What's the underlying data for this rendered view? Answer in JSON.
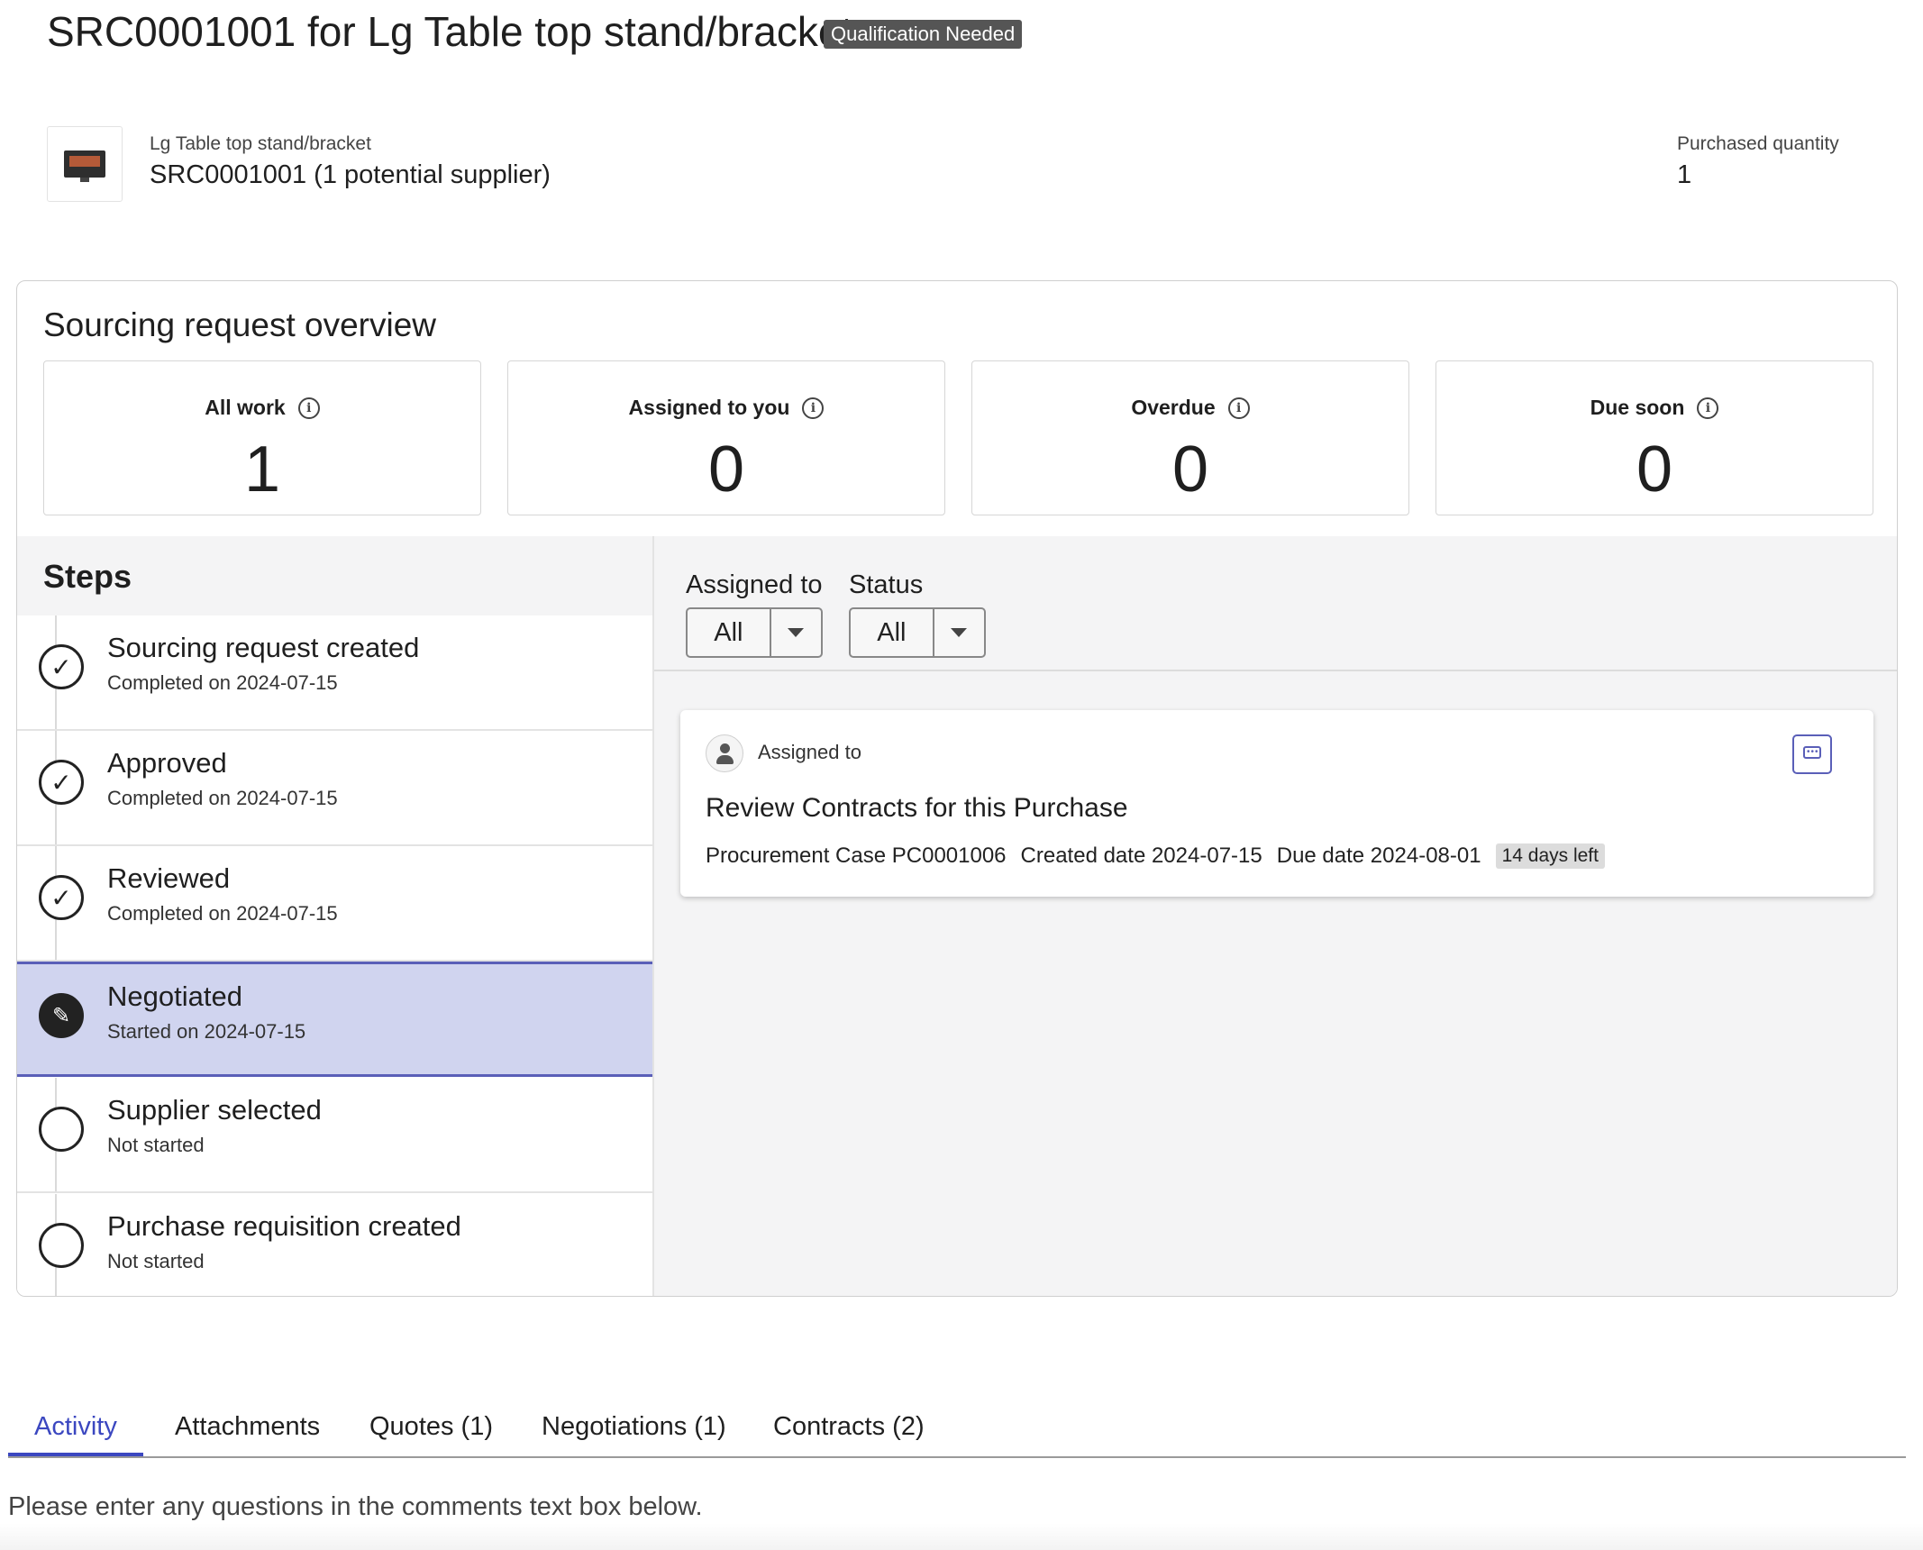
{
  "header": {
    "title": "SRC0001001 for Lg Table top stand/bracket",
    "badge": "Qualification Needed"
  },
  "item": {
    "name": "Lg Table top stand/bracket",
    "reference": "SRC0001001 (1 potential supplier)",
    "quantity_label": "Purchased quantity",
    "quantity_value": "1"
  },
  "overview": {
    "title": "Sourcing request overview",
    "stats": [
      {
        "label": "All work",
        "value": "1"
      },
      {
        "label": "Assigned to you",
        "value": "0"
      },
      {
        "label": "Overdue",
        "value": "0"
      },
      {
        "label": "Due soon",
        "value": "0"
      }
    ]
  },
  "steps": {
    "title": "Steps",
    "items": [
      {
        "title": "Sourcing request created",
        "subtitle": "Completed on 2024-07-15",
        "state": "done"
      },
      {
        "title": "Approved",
        "subtitle": "Completed on 2024-07-15",
        "state": "done"
      },
      {
        "title": "Reviewed",
        "subtitle": "Completed on 2024-07-15",
        "state": "done"
      },
      {
        "title": "Negotiated",
        "subtitle": "Started on 2024-07-15",
        "state": "current"
      },
      {
        "title": "Supplier selected",
        "subtitle": "Not started",
        "state": "pending"
      },
      {
        "title": "Purchase requisition created",
        "subtitle": "Not started",
        "state": "pending"
      }
    ]
  },
  "filters": {
    "assigned_label": "Assigned to",
    "assigned_value": "All",
    "status_label": "Status",
    "status_value": "All"
  },
  "task": {
    "assigned_label": "Assigned to",
    "title": "Review Contracts for this Purchase",
    "case": "Procurement Case PC0001006",
    "created": "Created date 2024-07-15",
    "due": "Due date 2024-08-01",
    "days_left": "14 days left"
  },
  "tabs": [
    {
      "label": "Activity",
      "active": true
    },
    {
      "label": "Attachments"
    },
    {
      "label": "Quotes (1)"
    },
    {
      "label": "Negotiations (1)"
    },
    {
      "label": "Contracts (2)"
    }
  ],
  "activity": {
    "message": "Please enter any questions in the comments text box below."
  },
  "colors": {
    "accent": "#3b47c0",
    "active_step_bg": "#d0d4ef",
    "badge_bg": "#555555"
  }
}
